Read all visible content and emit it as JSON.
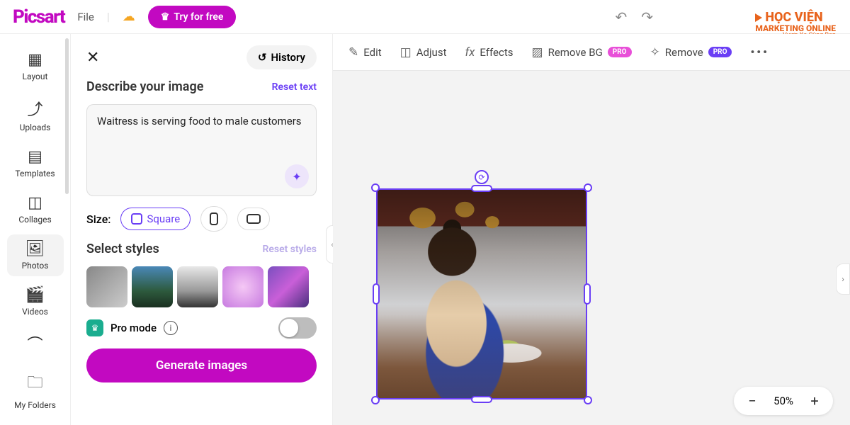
{
  "brand": "Picsart",
  "topbar": {
    "file": "File",
    "try_free": "Try for free"
  },
  "watermark": {
    "line1": "HỌC VIỆN",
    "line2a": "MARKETING ",
    "line2b": "ONLINE",
    "line3": "Vươn Xa Cùng Bạn"
  },
  "rail": {
    "layout": "Layout",
    "uploads": "Uploads",
    "templates": "Templates",
    "collages": "Collages",
    "photos": "Photos",
    "videos": "Videos",
    "myfolders": "My Folders"
  },
  "panel": {
    "history": "History",
    "describe": "Describe your image",
    "reset_text": "Reset text",
    "prompt": "Waitress is serving food to male customers",
    "size_label": "Size:",
    "square": "Square",
    "select_styles": "Select styles",
    "reset_styles": "Reset styles",
    "pro_mode": "Pro mode",
    "generate": "Generate images"
  },
  "toolbar": {
    "edit": "Edit",
    "adjust": "Adjust",
    "effects": "Effects",
    "removebg": "Remove BG",
    "remove": "Remove",
    "pro": "PRO"
  },
  "zoom": {
    "value": "50%"
  }
}
